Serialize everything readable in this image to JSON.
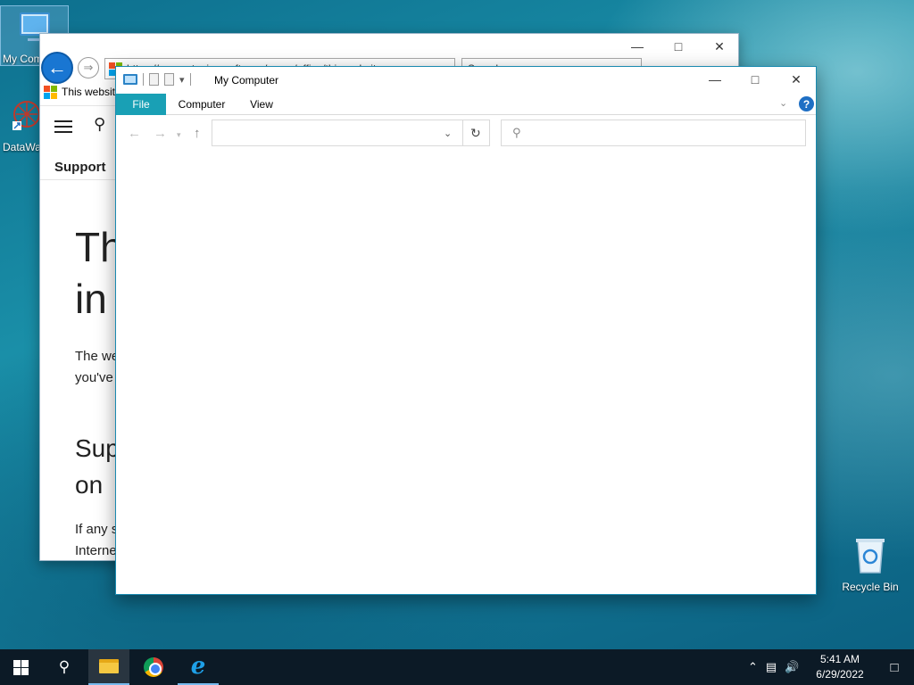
{
  "desktop": {
    "icons": {
      "my_computer": "My Computer",
      "datawa": "DataWa",
      "recycle_bin": "Recycle Bin"
    }
  },
  "browser": {
    "address": "https://support.microsoft.com/en-us/office/this-website",
    "search_placeholder": "Search...",
    "tab_title": "This website",
    "nav_support": "Support",
    "heading_line1": "Th",
    "heading_line2": "in",
    "para1_line1": "The we",
    "para1_line2": "you've",
    "heading2_line1": "Sup",
    "heading2_line2": "on",
    "para2_line1": "If any s",
    "para2_line2": "Interne"
  },
  "explorer": {
    "title": "My Computer",
    "ribbon_tabs": [
      "File",
      "Computer",
      "View"
    ],
    "address_value": "",
    "search_placeholder": ""
  },
  "taskbar": {
    "time": "5:41 AM",
    "date": "6/29/2022"
  },
  "colors": {
    "accent_file_tab": "#19a0b5",
    "taskbar_bg": "#0c1a26"
  }
}
